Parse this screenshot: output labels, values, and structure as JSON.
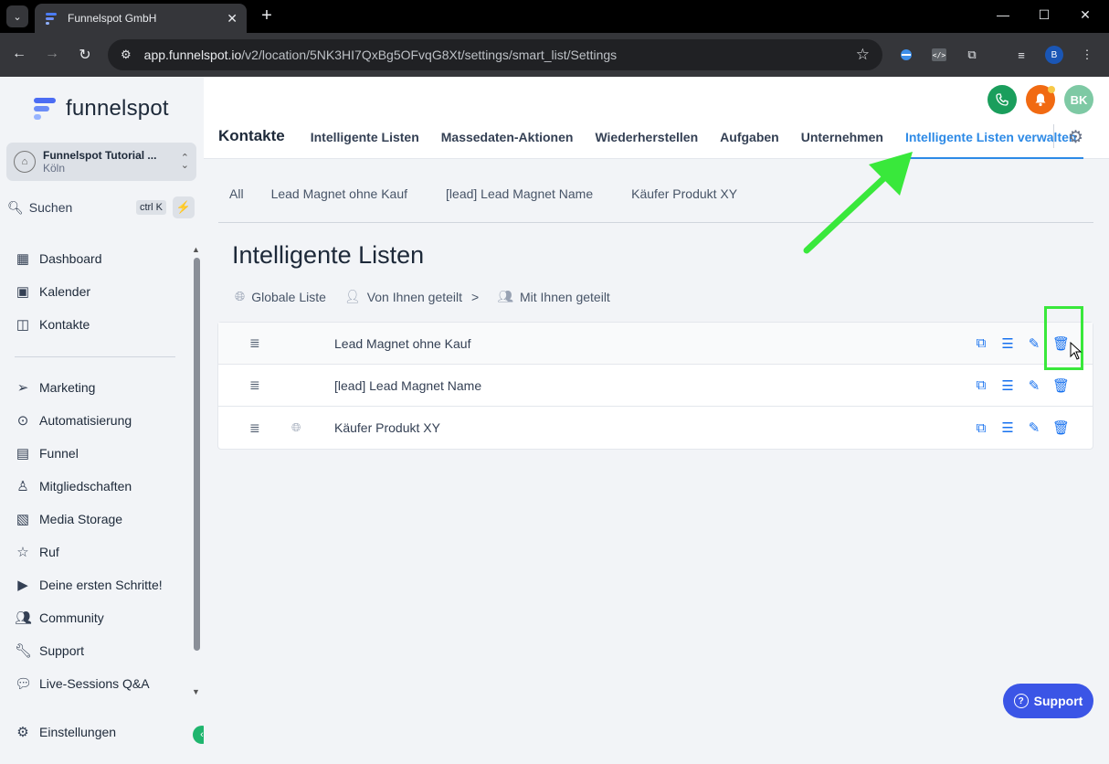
{
  "browser": {
    "tab_title": "Funnelspot GmbH",
    "url_host": "app.funnelspot.io",
    "url_path": "/v2/location/5NK3HI7QxBg5OFvqG8Xt/settings/smart_list/Settings",
    "profile_initial": "B"
  },
  "sidebar": {
    "logo_text": "funnelspot",
    "account_name": "Funnelspot Tutorial ...",
    "account_city": "Köln",
    "search_label": "Suchen",
    "search_shortcut": "ctrl K",
    "items": [
      {
        "label": "Dashboard",
        "icon": "grid-icon"
      },
      {
        "label": "Kalender",
        "icon": "calendar-icon"
      },
      {
        "label": "Kontakte",
        "icon": "contacts-icon"
      },
      {
        "label": "Marketing",
        "icon": "send-icon"
      },
      {
        "label": "Automatisierung",
        "icon": "automation-icon"
      },
      {
        "label": "Funnel",
        "icon": "funnel-icon"
      },
      {
        "label": "Mitgliedschaften",
        "icon": "badge-icon"
      },
      {
        "label": "Media Storage",
        "icon": "image-icon"
      },
      {
        "label": "Ruf",
        "icon": "star-icon"
      },
      {
        "label": "Deine ersten Schritte!",
        "icon": "play-icon"
      },
      {
        "label": "Community",
        "icon": "users-icon"
      },
      {
        "label": "Support",
        "icon": "wrench-icon"
      },
      {
        "label": "Live-Sessions Q&A",
        "icon": "chat-icon"
      }
    ],
    "settings_label": "Einstellungen"
  },
  "header": {
    "avatar_initials": "BK",
    "section_title": "Kontakte",
    "tabs": [
      {
        "label": "Intelligente Listen",
        "active": false
      },
      {
        "label": "Massedaten-Aktionen",
        "active": false
      },
      {
        "label": "Wiederherstellen",
        "active": false
      },
      {
        "label": "Aufgaben",
        "active": false
      },
      {
        "label": "Unternehmen",
        "active": false
      },
      {
        "label": "Intelligente Listen verwalten",
        "active": true
      }
    ]
  },
  "content": {
    "subtabs": [
      "All",
      "Lead Magnet ohne Kauf",
      "[lead] Lead Magnet Name",
      "Käufer Produkt XY"
    ],
    "page_title": "Intelligente Listen",
    "filters": [
      {
        "label": "Globale Liste",
        "icon": "globe-icon"
      },
      {
        "label": "Von Ihnen geteilt",
        "icon": "user-share-icon",
        "suffix": ">"
      },
      {
        "label": "Mit Ihnen geteilt",
        "icon": "users-icon"
      }
    ],
    "lists": [
      {
        "name": "Lead Magnet ohne Kauf",
        "global": false
      },
      {
        "name": "[lead] Lead Magnet Name",
        "global": false
      },
      {
        "name": "Käufer Produkt XY",
        "global": true
      }
    ],
    "support_button": "Support"
  },
  "colors": {
    "accent": "#2d8ae6",
    "action": "#1570ef",
    "highlight": "#39e83b",
    "phone": "#1a9e5c",
    "bell": "#f16a12",
    "avatar": "#7ec9a4",
    "support": "#3b55e6"
  }
}
